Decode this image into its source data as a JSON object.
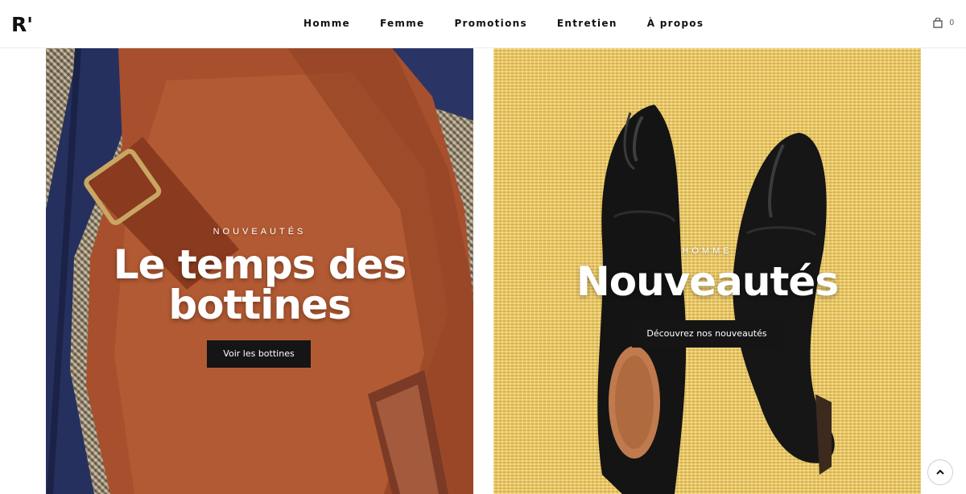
{
  "header": {
    "logo": "R'",
    "nav": [
      "Homme",
      "Femme",
      "Promotions",
      "Entretien",
      "À propos"
    ],
    "cart_count": "0"
  },
  "panels": [
    {
      "eyebrow": "NOUVEAUTÉS",
      "title_line1": "Le temps des",
      "title_line2": "bottines",
      "button": "Voir les bottines"
    },
    {
      "eyebrow": "HOMME",
      "title_line1": "Nouveautés",
      "button": "Découvrez nos nouveautés"
    }
  ],
  "icons": {
    "cart": "shopping-bag-icon",
    "scroll_top": "chevron-up-icon"
  },
  "colors": {
    "button_bg": "#151515",
    "text_light": "#ffffff",
    "left_panel_bg": "#8d8270",
    "right_panel_bg": "#e8c35c"
  }
}
